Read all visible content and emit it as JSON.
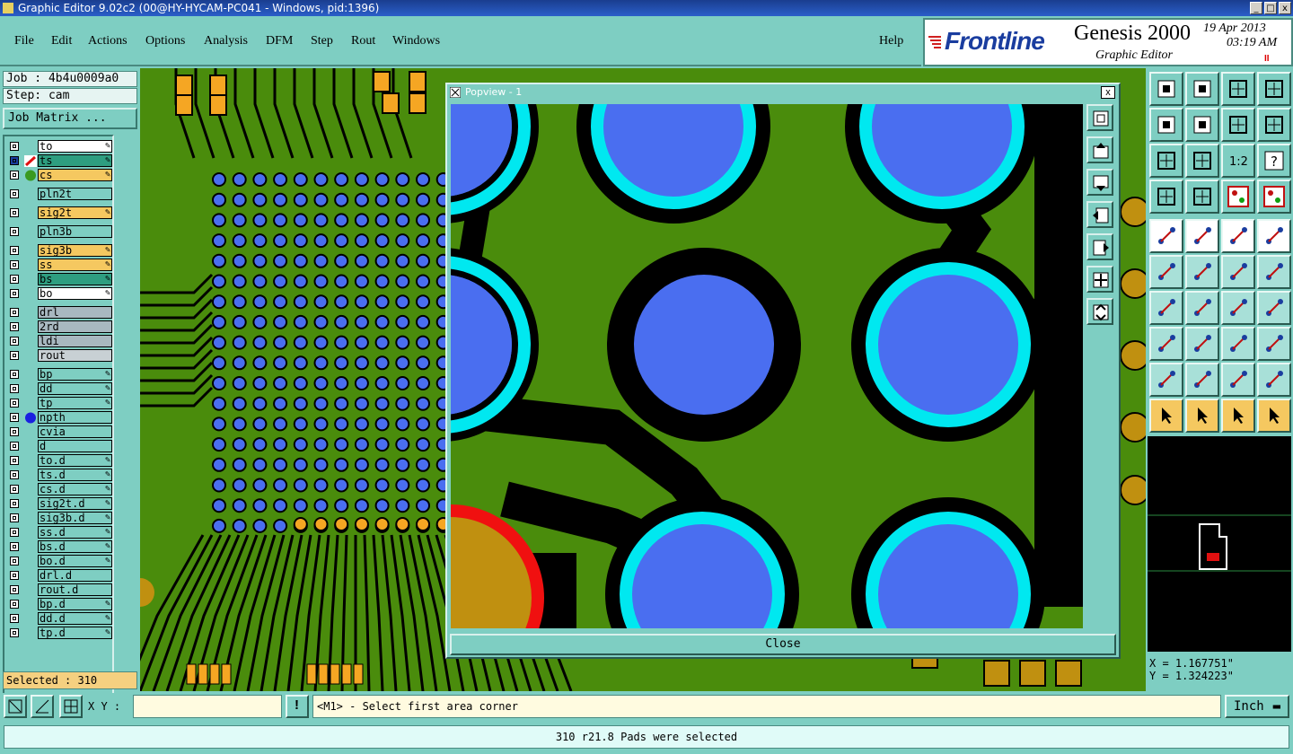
{
  "window": {
    "title": "Graphic Editor 9.02c2 (00@HY-HYCAM-PC041 - Windows, pid:1396)",
    "min": "_",
    "max": "□",
    "close": "x"
  },
  "menu": [
    "File",
    "Edit",
    "Actions",
    "Options",
    "Analysis",
    "DFM",
    "Step",
    "Rout",
    "Windows"
  ],
  "help": "Help",
  "brand": {
    "logo": "Frontline",
    "product": "Genesis 2000",
    "subtitle": "Graphic Editor",
    "date": "19 Apr 2013",
    "time": "03:19 AM",
    "pause": "II"
  },
  "job": "Job : 4b4u0009a0",
  "step": "Step: cam",
  "job_matrix": "Job Matrix ...",
  "colors": {
    "board": "#4a8c0c",
    "copper": "#000000",
    "pad": "#4a6ef0",
    "highlight": "#00e8f0",
    "orange": "#f5a623",
    "gold": "#c09010"
  },
  "layers": [
    {
      "name": "to",
      "color": "#ffffff",
      "pen": true,
      "ind": ""
    },
    {
      "name": "ts",
      "color": "#2e9e80",
      "pen": true,
      "ind": "red",
      "selected": true
    },
    {
      "name": "cs",
      "color": "#f5c860",
      "pen": true,
      "ind": "green"
    },
    {
      "name": "pln2t",
      "color": "#7ecec2",
      "pen": false,
      "ind": "",
      "gap": true
    },
    {
      "name": "sig2t",
      "color": "#f5c860",
      "pen": true,
      "ind": "",
      "gap": true
    },
    {
      "name": "pln3b",
      "color": "#7ecec2",
      "pen": false,
      "ind": "",
      "gap": true
    },
    {
      "name": "sig3b",
      "color": "#f5c860",
      "pen": true,
      "ind": "",
      "gap": true
    },
    {
      "name": "ss",
      "color": "#f5c860",
      "pen": true,
      "ind": ""
    },
    {
      "name": "bs",
      "color": "#2e9e80",
      "pen": true,
      "ind": ""
    },
    {
      "name": "bo",
      "color": "#ffffff",
      "pen": true,
      "ind": ""
    },
    {
      "name": "drl",
      "color": "#a8b8c0",
      "pen": false,
      "ind": "",
      "gap": true
    },
    {
      "name": "2rd",
      "color": "#a8b8c0",
      "pen": false,
      "ind": ""
    },
    {
      "name": "ldi",
      "color": "#a8b8c0",
      "pen": false,
      "ind": ""
    },
    {
      "name": "rout",
      "color": "#c8d0d4",
      "pen": false,
      "ind": ""
    },
    {
      "name": "bp",
      "color": "#7ecec2",
      "pen": true,
      "ind": "",
      "gap": true
    },
    {
      "name": "dd",
      "color": "#7ecec2",
      "pen": true,
      "ind": ""
    },
    {
      "name": "tp",
      "color": "#7ecec2",
      "pen": true,
      "ind": ""
    },
    {
      "name": "npth",
      "color": "#7ecec2",
      "pen": false,
      "ind": "blue"
    },
    {
      "name": "cvia",
      "color": "#7ecec2",
      "pen": false,
      "ind": ""
    },
    {
      "name": "d",
      "color": "#7ecec2",
      "pen": false,
      "ind": ""
    },
    {
      "name": "to.d",
      "color": "#7ecec2",
      "pen": true,
      "ind": ""
    },
    {
      "name": "ts.d",
      "color": "#7ecec2",
      "pen": true,
      "ind": ""
    },
    {
      "name": "cs.d",
      "color": "#7ecec2",
      "pen": true,
      "ind": ""
    },
    {
      "name": "sig2t.d",
      "color": "#7ecec2",
      "pen": true,
      "ind": ""
    },
    {
      "name": "sig3b.d",
      "color": "#7ecec2",
      "pen": true,
      "ind": ""
    },
    {
      "name": "ss.d",
      "color": "#7ecec2",
      "pen": true,
      "ind": ""
    },
    {
      "name": "bs.d",
      "color": "#7ecec2",
      "pen": true,
      "ind": ""
    },
    {
      "name": "bo.d",
      "color": "#7ecec2",
      "pen": true,
      "ind": ""
    },
    {
      "name": "drl.d",
      "color": "#7ecec2",
      "pen": false,
      "ind": ""
    },
    {
      "name": "rout.d",
      "color": "#7ecec2",
      "pen": false,
      "ind": ""
    },
    {
      "name": "bp.d",
      "color": "#7ecec2",
      "pen": true,
      "ind": ""
    },
    {
      "name": "dd.d",
      "color": "#7ecec2",
      "pen": true,
      "ind": ""
    },
    {
      "name": "tp.d",
      "color": "#7ecec2",
      "pen": true,
      "ind": ""
    }
  ],
  "selected": "Selected : 310",
  "popview": {
    "title": "Popview - 1",
    "close_x": "x",
    "close_label": "Close"
  },
  "coords": {
    "x": "X = 1.167751\"",
    "y": "Y = 1.324223\""
  },
  "toolbar_scale_label": "1:2",
  "toolbar_help_label": "?",
  "xy_label": "X Y :",
  "xy_value": "",
  "prompt_text": "<M1> - Select first area corner",
  "units": "Inch",
  "status": "310 r21.8 Pads were selected"
}
